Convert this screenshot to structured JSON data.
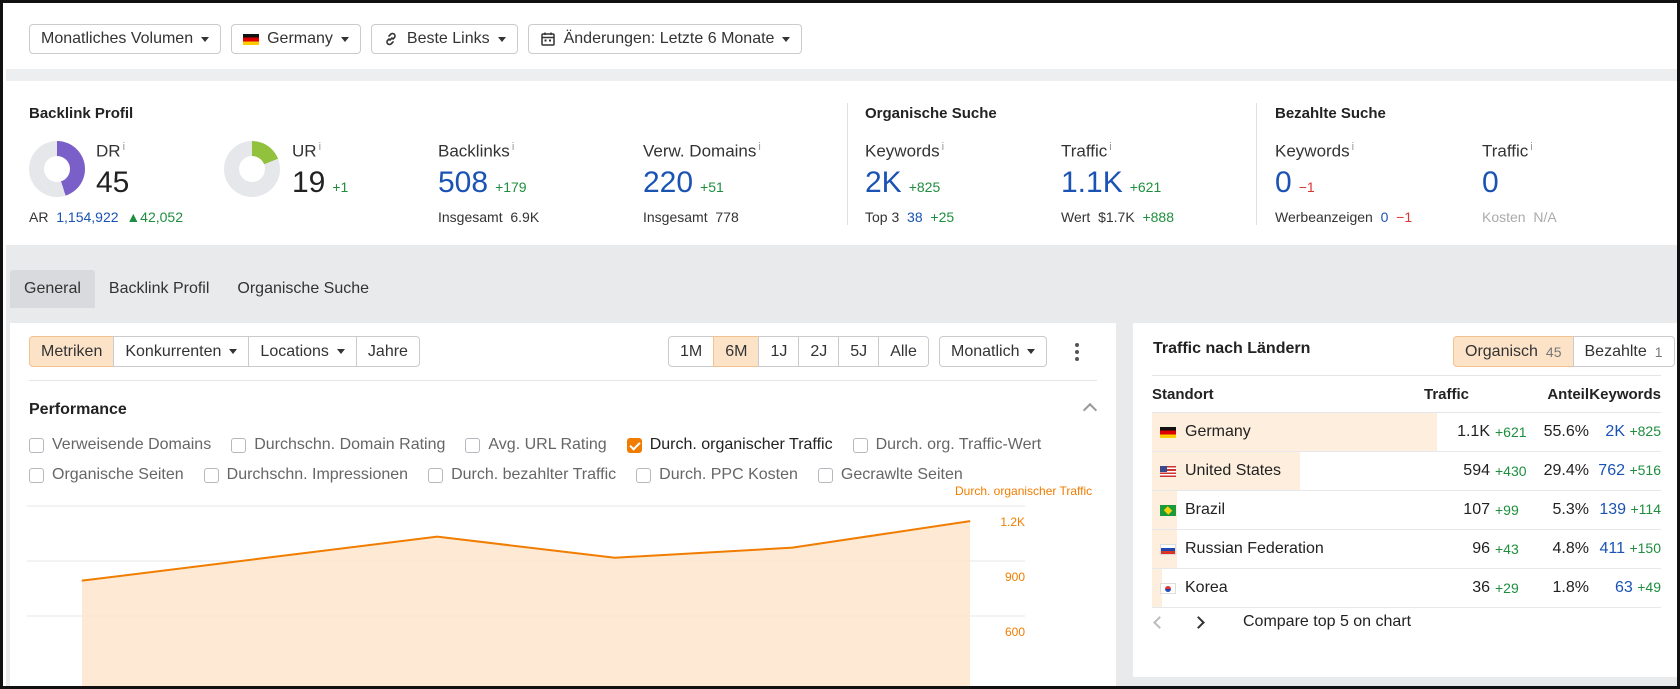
{
  "toolbar": {
    "volume": "Monatliches Volumen",
    "country": "Germany",
    "links": "Beste Links",
    "changes": "Änderungen: Letzte 6 Monate"
  },
  "overview": {
    "backlink_title": "Backlink Profil",
    "organic_title": "Organische Suche",
    "paid_title": "Bezahlte Suche",
    "dr": {
      "label": "DR",
      "value": "45",
      "donut_fraction": 0.45
    },
    "ar": {
      "label": "AR",
      "value": "1,154,922",
      "delta": "42,052"
    },
    "ur": {
      "label": "UR",
      "value": "19",
      "delta": "+1",
      "donut_fraction": 0.19
    },
    "backlinks": {
      "label": "Backlinks",
      "value": "508",
      "delta": "+179",
      "sub_label": "Insgesamt",
      "sub_value": "6.9K"
    },
    "domains": {
      "label": "Verw. Domains",
      "value": "220",
      "delta": "+51",
      "sub_label": "Insgesamt",
      "sub_value": "778"
    },
    "org_keywords": {
      "label": "Keywords",
      "value": "2K",
      "delta": "+825",
      "sub_label": "Top 3",
      "sub_value": "38",
      "sub_delta": "+25"
    },
    "org_traffic": {
      "label": "Traffic",
      "value": "1.1K",
      "delta": "+621",
      "sub_label": "Wert",
      "sub_value": "$1.7K",
      "sub_delta": "+888"
    },
    "paid_keywords": {
      "label": "Keywords",
      "value": "0",
      "delta": "−1",
      "sub_label": "Werbeanzeigen",
      "sub_value": "0",
      "sub_delta": "−1"
    },
    "paid_traffic": {
      "label": "Traffic",
      "value": "0",
      "sub_label": "Kosten",
      "sub_value": "N/A"
    },
    "info": "i"
  },
  "tabs": [
    "General",
    "Backlink Profil",
    "Organische Suche"
  ],
  "left": {
    "modes": [
      "Metriken",
      "Konkurrenten",
      "Locations",
      "Jahre"
    ],
    "ranges": [
      "1M",
      "6M",
      "1J",
      "2J",
      "5J",
      "Alle"
    ],
    "interval": "Monatlich",
    "perf_title": "Performance",
    "checks_row1": [
      "Verweisende Domains",
      "Durchschn. Domain Rating",
      "Avg. URL Rating",
      "Durch. organischer Traffic",
      "Durch. org. Traffic-Wert"
    ],
    "checks_row2": [
      "Organische Seiten",
      "Durchschn. Impressionen",
      "Durch. bezahlter Traffic",
      "Durch. PPC Kosten",
      "Gecrawlte Seiten"
    ],
    "checked": "Durch. organischer Traffic"
  },
  "chart_data": {
    "type": "area",
    "series": [
      {
        "name": "Durch. organischer Traffic",
        "values": [
          880,
          1000,
          1120,
          1005,
          1060,
          1205
        ]
      }
    ],
    "y_ticks": [
      "1.2K",
      "900",
      "600"
    ],
    "color": "#f07d00"
  },
  "right": {
    "title": "Traffic nach Ländern",
    "tab_organic": "Organisch",
    "tab_organic_count": "45",
    "tab_paid": "Bezahlte",
    "tab_paid_count": "1",
    "headers": {
      "loc": "Standort",
      "traffic": "Traffic",
      "share": "Anteil",
      "keywords": "Keywords"
    },
    "rows": [
      {
        "flag": "de",
        "country": "Germany",
        "traffic": "1.1K",
        "traffic_delta": "+621",
        "share": "55.6%",
        "share_fraction": 0.556,
        "keywords": "2K",
        "kw_delta": "+825"
      },
      {
        "flag": "us",
        "country": "United States",
        "traffic": "594",
        "traffic_delta": "+430",
        "share": "29.4%",
        "share_fraction": 0.294,
        "keywords": "762",
        "kw_delta": "+516"
      },
      {
        "flag": "br",
        "country": "Brazil",
        "traffic": "107",
        "traffic_delta": "+99",
        "share": "5.3%",
        "share_fraction": 0.053,
        "keywords": "139",
        "kw_delta": "+114"
      },
      {
        "flag": "ru",
        "country": "Russian Federation",
        "traffic": "96",
        "traffic_delta": "+43",
        "share": "4.8%",
        "share_fraction": 0.048,
        "keywords": "411",
        "kw_delta": "+150"
      },
      {
        "flag": "kr",
        "country": "Korea",
        "traffic": "36",
        "traffic_delta": "+29",
        "share": "1.8%",
        "share_fraction": 0.018,
        "keywords": "63",
        "kw_delta": "+49"
      }
    ],
    "compare": "Compare top 5 on chart"
  }
}
